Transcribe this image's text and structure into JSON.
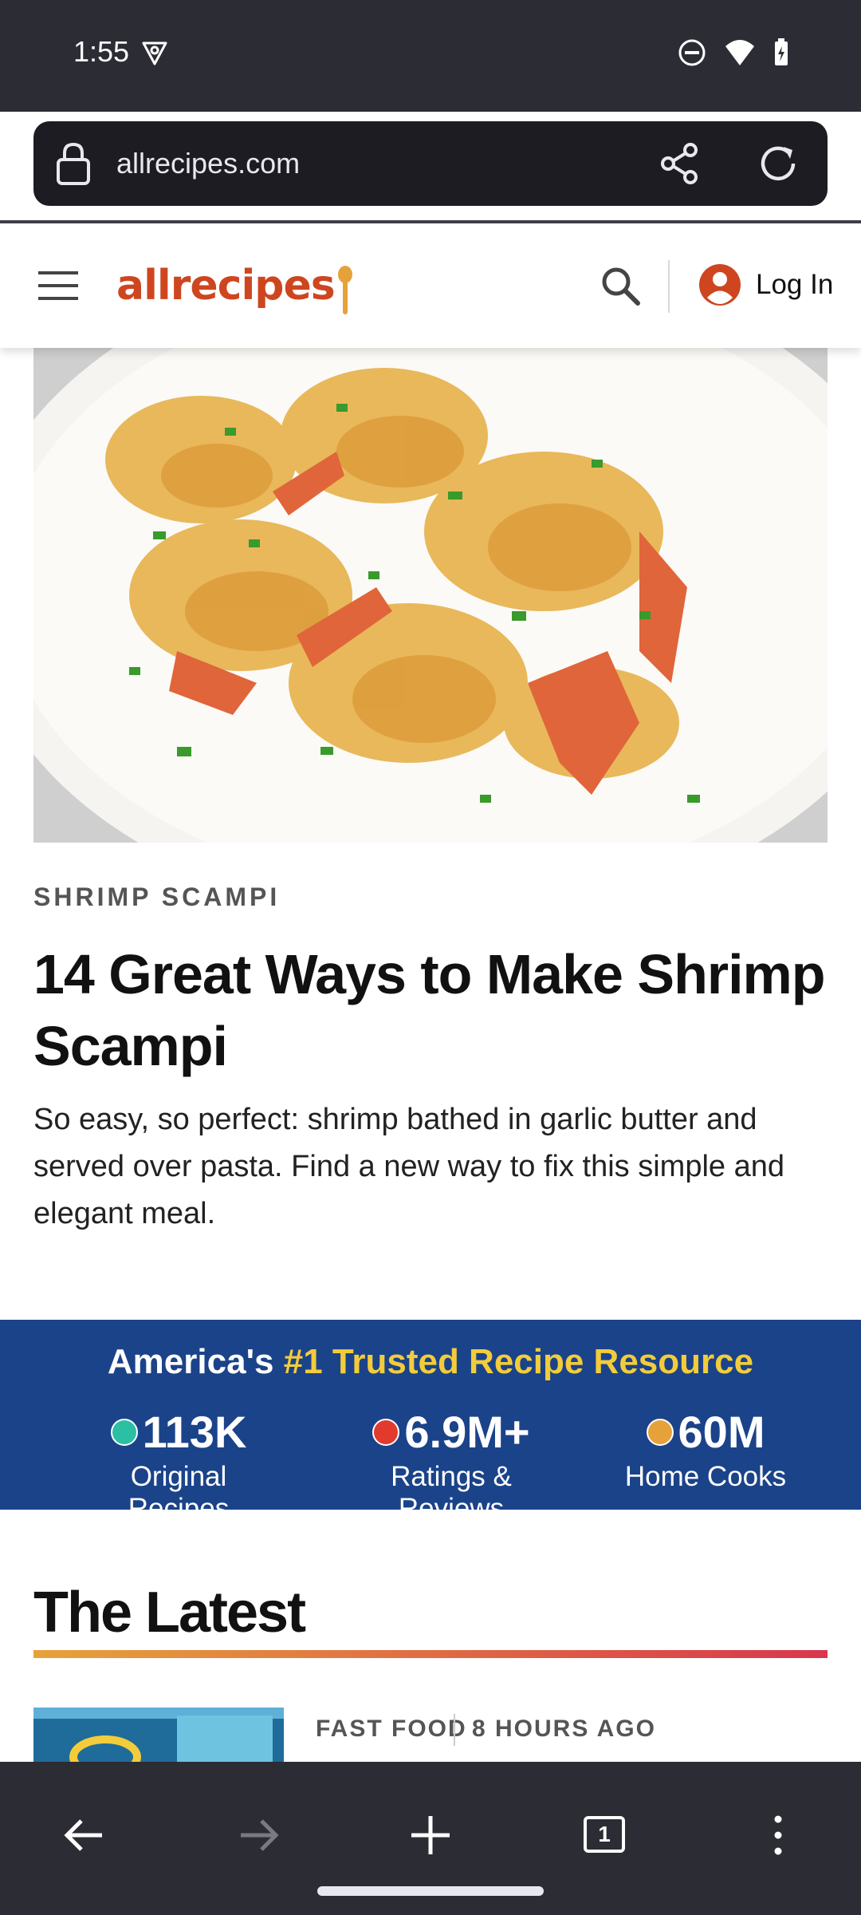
{
  "status_bar": {
    "time": "1:55"
  },
  "browser": {
    "url": "allrecipes.com"
  },
  "header": {
    "logo": "allrecipes",
    "login_label": "Log In"
  },
  "article": {
    "category": "SHRIMP SCAMPI",
    "title": "14 Great Ways to Make Shrimp Scampi",
    "description": "So easy, so perfect: shrimp bathed in garlic butter and served over pasta. Find a new way to fix this simple and elegant meal."
  },
  "trust": {
    "title_prefix": "America's",
    "title_highlight": "#1 Trusted Recipe Resource",
    "stats": [
      {
        "value": "113K",
        "label": "Original Recipes",
        "color": "#2bbfa4"
      },
      {
        "value": "6.9M+",
        "label": "Ratings & Reviews",
        "color": "#e23b2e"
      },
      {
        "value": "60M",
        "label": "Home Cooks",
        "color": "#e6a23a"
      }
    ]
  },
  "latest": {
    "heading": "The Latest",
    "items": [
      {
        "tag": "FAST FOOD",
        "time": "8 HOURS AGO"
      }
    ]
  },
  "navbar": {
    "tab_count": "1"
  },
  "colors": {
    "brand": "#ce4620",
    "band": "#1b4389",
    "highlight": "#f3cc3b"
  }
}
